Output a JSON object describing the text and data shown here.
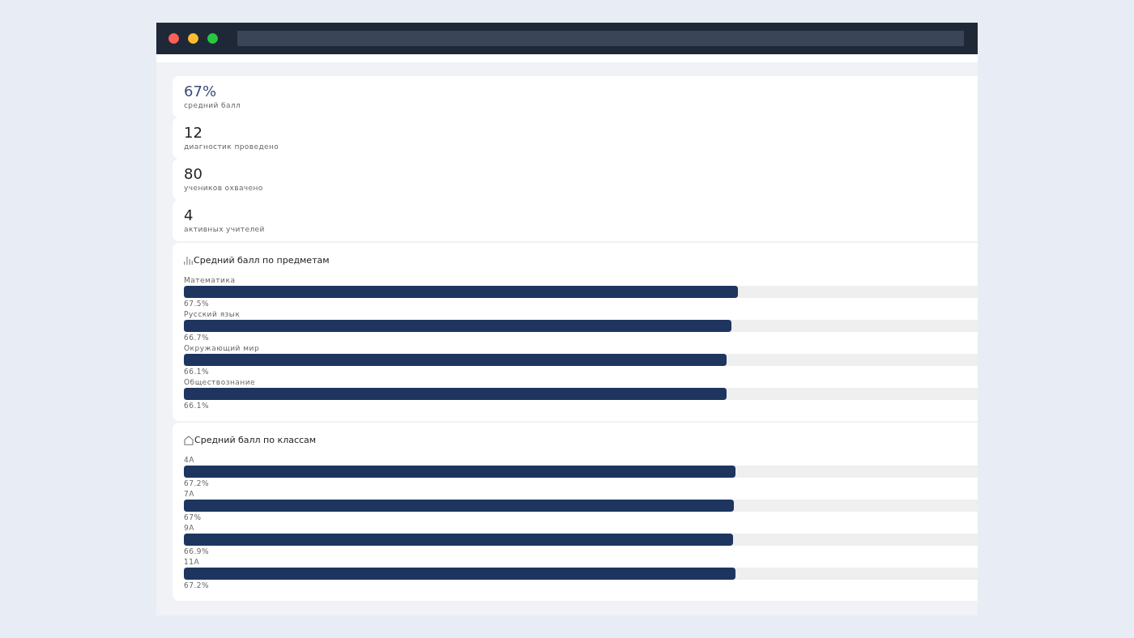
{
  "stats": [
    {
      "value": "67%",
      "label": "средний балл",
      "accent": true
    },
    {
      "value": "12",
      "label": "диагностик проведено",
      "accent": false
    },
    {
      "value": "80",
      "label": "учеников охвачено",
      "accent": false
    },
    {
      "value": "4",
      "label": "активных учителей",
      "accent": false
    }
  ],
  "sections": [
    {
      "kind": "subjects",
      "title": "Средний балл по предметам",
      "items": [
        {
          "name": "Математика",
          "level": 0.675,
          "reading": "67.5%"
        },
        {
          "name": "Русский язык",
          "level": 0.667,
          "reading": "66.7%"
        },
        {
          "name": "Окружающий мир",
          "level": 0.661,
          "reading": "66.1%"
        },
        {
          "name": "Обществознание",
          "level": 0.661,
          "reading": "66.1%"
        }
      ]
    },
    {
      "kind": "classes",
      "title": "Средний балл по классам",
      "items": [
        {
          "name": "4А",
          "level": 0.672,
          "reading": "67.2%"
        },
        {
          "name": "7А",
          "level": 0.67,
          "reading": "67%"
        },
        {
          "name": "9А",
          "level": 0.669,
          "reading": "66.9%"
        },
        {
          "name": "11А",
          "level": 0.672,
          "reading": "67.2%"
        }
      ]
    }
  ]
}
